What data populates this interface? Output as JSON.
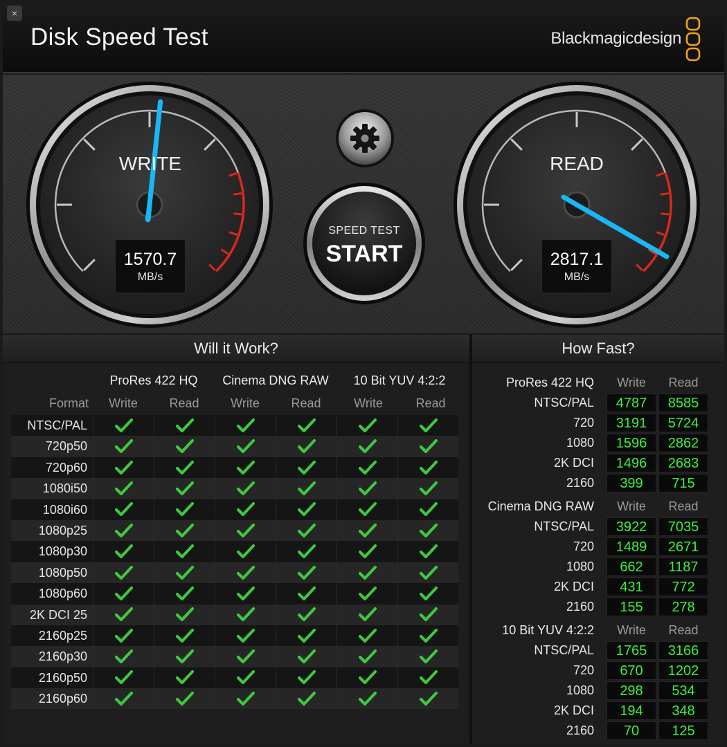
{
  "window": {
    "title": "Disk Speed Test",
    "close_glyph": "×",
    "brand": "Blackmagicdesign",
    "brand_color": "#f3a21b"
  },
  "gauges": {
    "write": {
      "label": "WRITE",
      "value": "1570.7",
      "unit": "MB/s",
      "needle_color": "#19b7f5"
    },
    "read": {
      "label": "READ",
      "value": "2817.1",
      "unit": "MB/s",
      "needle_color": "#19b7f5"
    },
    "redline_color": "#d8281e"
  },
  "controls": {
    "settings_icon": "gear-icon",
    "start_caption": "SPEED TEST",
    "start_label": "START"
  },
  "will_it_work": {
    "header": "Will it Work?",
    "format_label": "Format",
    "codecs": [
      "ProRes 422 HQ",
      "Cinema DNG RAW",
      "10 Bit YUV 4:2:2"
    ],
    "write_label": "Write",
    "read_label": "Read",
    "check_icon": "checkmark-icon",
    "check_color": "#3fc83f",
    "formats": [
      "NTSC/PAL",
      "720p50",
      "720p60",
      "1080i50",
      "1080i60",
      "1080p25",
      "1080p30",
      "1080p50",
      "1080p60",
      "2K DCI 25",
      "2160p25",
      "2160p30",
      "2160p50",
      "2160p60"
    ]
  },
  "how_fast": {
    "header": "How Fast?",
    "write_label": "Write",
    "read_label": "Read",
    "value_color": "#3cf23c",
    "groups": [
      {
        "codec": "ProRes 422 HQ",
        "rows": [
          {
            "format": "NTSC/PAL",
            "write": "4787",
            "read": "8585"
          },
          {
            "format": "720",
            "write": "3191",
            "read": "5724"
          },
          {
            "format": "1080",
            "write": "1596",
            "read": "2862"
          },
          {
            "format": "2K DCI",
            "write": "1496",
            "read": "2683"
          },
          {
            "format": "2160",
            "write": "399",
            "read": "715"
          }
        ]
      },
      {
        "codec": "Cinema DNG RAW",
        "rows": [
          {
            "format": "NTSC/PAL",
            "write": "3922",
            "read": "7035"
          },
          {
            "format": "720",
            "write": "1489",
            "read": "2671"
          },
          {
            "format": "1080",
            "write": "662",
            "read": "1187"
          },
          {
            "format": "2K DCI",
            "write": "431",
            "read": "772"
          },
          {
            "format": "2160",
            "write": "155",
            "read": "278"
          }
        ]
      },
      {
        "codec": "10 Bit YUV 4:2:2",
        "rows": [
          {
            "format": "NTSC/PAL",
            "write": "1765",
            "read": "3166"
          },
          {
            "format": "720",
            "write": "670",
            "read": "1202"
          },
          {
            "format": "1080",
            "write": "298",
            "read": "534"
          },
          {
            "format": "2K DCI",
            "write": "194",
            "read": "348"
          },
          {
            "format": "2160",
            "write": "70",
            "read": "125"
          }
        ]
      }
    ]
  }
}
